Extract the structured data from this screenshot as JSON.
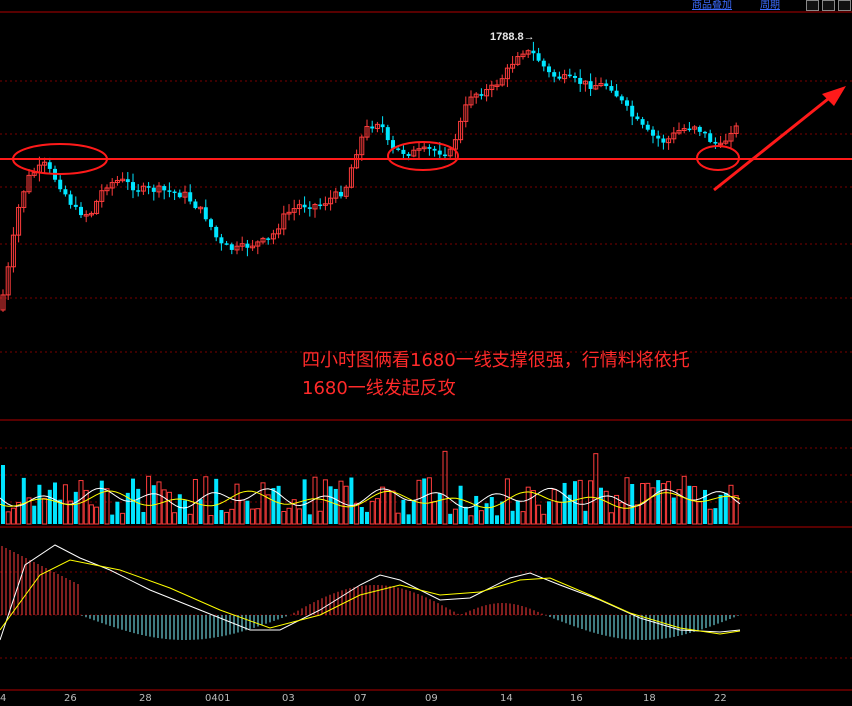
{
  "toolbar": {
    "add_product": "商品叠加",
    "period": "周期"
  },
  "annotation": {
    "line1": "四小时图俩看1680一线支撑很强，行情料将依托",
    "line2": "1680一线发起反攻"
  },
  "peak_label": "1788.8",
  "colors": {
    "up": "#ff3c3c",
    "down": "#00e5ff",
    "support_line": "#ff1a1a",
    "ma_white": "#ffffff",
    "ma_yellow": "#ffff00",
    "background": "#000000"
  },
  "chart_data": {
    "type": "candlestick",
    "x_tick_labels": [
      "4",
      "26",
      "28",
      "0401",
      "03",
      "07",
      "09",
      "14",
      "16",
      "18",
      "22"
    ],
    "support_level": 1680,
    "peak_value": 1788.8,
    "panels": [
      "price",
      "volume",
      "macd"
    ]
  }
}
